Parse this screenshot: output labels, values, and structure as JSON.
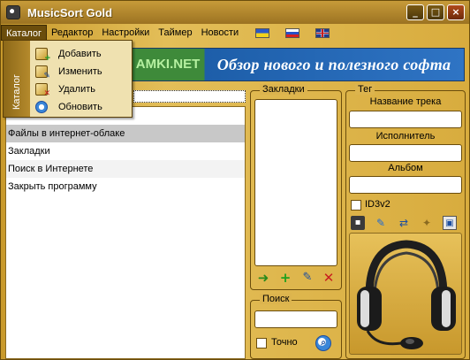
{
  "window": {
    "title": "MusicSort Gold",
    "buttons": {
      "minimize": "_",
      "maximize": "□",
      "close": "×"
    }
  },
  "menu": {
    "items": [
      "Каталог",
      "Редактор",
      "Настройки",
      "Таймер",
      "Новости"
    ],
    "active": "Каталог",
    "flags": [
      "ua-flag-icon",
      "ru-flag-icon",
      "gb-flag-icon"
    ]
  },
  "catalog_menu": {
    "side_label": "Каталог",
    "items": [
      {
        "label": "Добавить",
        "icon": "add-catalog-icon"
      },
      {
        "label": "Изменить",
        "icon": "edit-catalog-icon"
      },
      {
        "label": "Удалить",
        "icon": "delete-catalog-icon"
      },
      {
        "label": "Обновить",
        "icon": "refresh-icon"
      }
    ]
  },
  "banner": {
    "left_text": "AMKI.NET",
    "right_text": "Обзор нового и полезного софта"
  },
  "catalog_list": {
    "rows": [
      "",
      "Файлы в интернет-облаке",
      "Закладки",
      "Поиск в Интернете",
      "Закрыть программу"
    ],
    "selected_index": 1
  },
  "bookmarks": {
    "label": "Закладки",
    "tools": [
      "go-icon",
      "add-icon",
      "edit-icon",
      "delete-icon"
    ]
  },
  "search": {
    "label": "Поиск",
    "value": "",
    "exact_label": "Точно",
    "exact_checked": false
  },
  "tag": {
    "label": "Тег",
    "track_label": "Название трека",
    "track_value": "",
    "artist_label": "Исполнитель",
    "artist_value": "",
    "album_label": "Альбом",
    "album_value": "",
    "id3_label": "ID3v2",
    "id3_checked": false,
    "tools": [
      "save-icon",
      "pen-icon",
      "swap-icon",
      "magic-icon",
      "image-icon"
    ]
  },
  "colors": {
    "gold": "#d4a93a",
    "dark_brown": "#6b4d0c",
    "banner_blue": "#2f74c4",
    "banner_green": "#3e8a3a"
  }
}
